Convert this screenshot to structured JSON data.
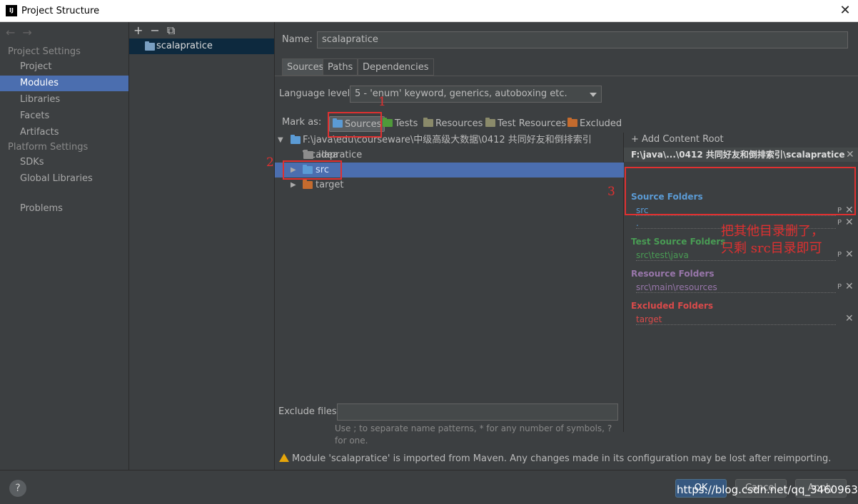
{
  "window": {
    "title": "Project Structure",
    "app_icon": "IJ",
    "close_glyph": "✕"
  },
  "nav": {
    "back": "←",
    "forward": "→",
    "project_settings": "Project Settings",
    "items_top": [
      "Project",
      "Modules",
      "Libraries",
      "Facets",
      "Artifacts"
    ],
    "platform_settings": "Platform Settings",
    "items_platform": [
      "SDKs",
      "Global Libraries"
    ],
    "problems": "Problems",
    "selected": "Modules"
  },
  "modules": {
    "add": "+",
    "remove": "−",
    "copy": "⧉",
    "items": [
      "scalapratice"
    ]
  },
  "main": {
    "name_label": "Name:",
    "name_value": "scalapratice",
    "tabs": [
      "Sources",
      "Paths",
      "Dependencies"
    ],
    "language_level_label": "Language level:",
    "language_level_value": "5 - 'enum' keyword, generics, autoboxing etc.",
    "mark_as_label": "Mark as:",
    "mark_buttons": [
      "Sources",
      "Tests",
      "Resources",
      "Test Resources",
      "Excluded"
    ],
    "tree": {
      "root": "F:\\java\\edu\\courseware\\中级高级大数据\\0412 共同好友和倒排索引\\scalapratice",
      "children": [
        ".idea",
        "src",
        "target"
      ],
      "selected": "src"
    },
    "exclude_label": "Exclude files:",
    "exclude_hint": "Use ; to separate name patterns, * for any number of symbols, ? for one.",
    "warning": "Module 'scalapratice' is imported from Maven. Any changes made in its configuration may be lost after reimporting."
  },
  "content_root": {
    "add_label": "Add Content Root",
    "path": "F:\\java\\...\\0412 共同好友和倒排索引\\scalapratice",
    "source_header": "Source Folders",
    "source_items": [
      "src",
      "."
    ],
    "test_header": "Test Source Folders",
    "test_items": [
      "src\\test\\java"
    ],
    "resource_header": "Resource Folders",
    "resource_items": [
      "src\\main\\resources"
    ],
    "excluded_header": "Excluded Folders",
    "excluded_items": [
      "target"
    ]
  },
  "annotations": {
    "n1": "1",
    "n2": "2",
    "n3": "3",
    "note_line1": "把其他目录删了，",
    "note_line2": "只剩 src目录即可"
  },
  "buttons": {
    "help": "?",
    "ok": "OK",
    "cancel": "Cancel",
    "apply": "Apply"
  },
  "watermark": "https://blog.csdn.net/qq_34609633",
  "colors": {
    "accent": "#4b6eaf",
    "sources": "#5b9bd5",
    "tests": "#4f9a3a",
    "resources": "#9876aa",
    "excluded": "#c75450",
    "annotation": "#e03030"
  }
}
